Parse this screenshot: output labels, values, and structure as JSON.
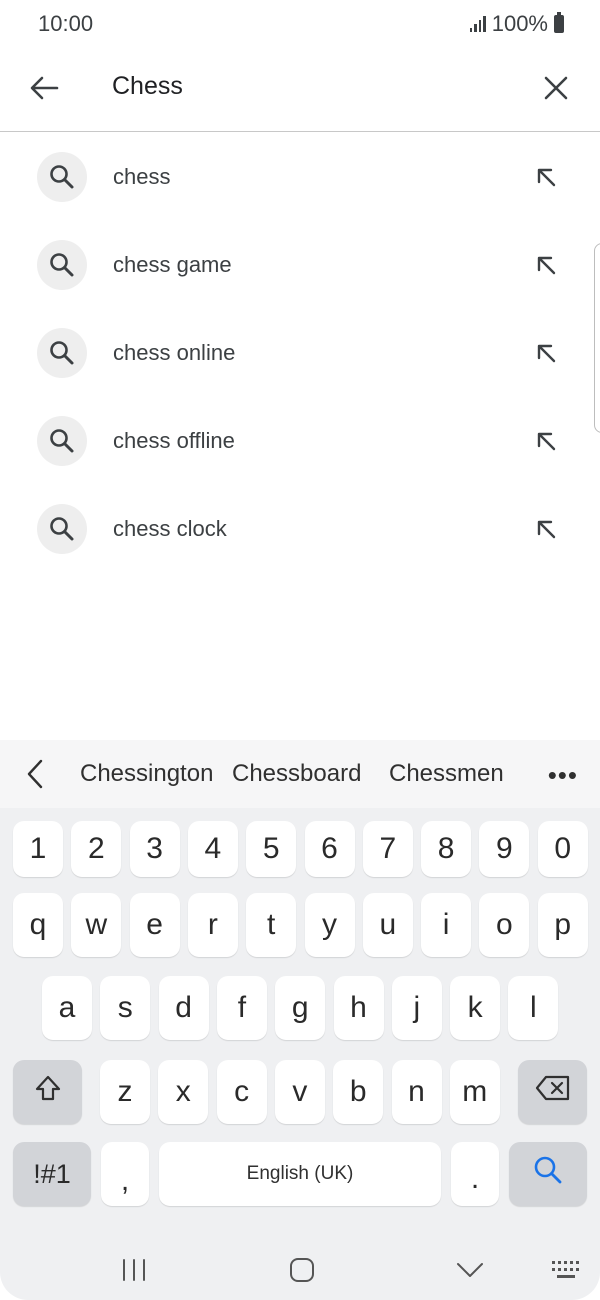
{
  "status_bar": {
    "time": "10:00",
    "battery": "100%"
  },
  "search": {
    "query": "Chess"
  },
  "suggestions": [
    {
      "text": "chess"
    },
    {
      "text": "chess game"
    },
    {
      "text": "chess online"
    },
    {
      "text": "chess offline"
    },
    {
      "text": "chess clock"
    }
  ],
  "keyboard": {
    "predictions": [
      "Chessington",
      "Chessboard",
      "Chessmen"
    ],
    "more": "•••",
    "number_row": [
      "1",
      "2",
      "3",
      "4",
      "5",
      "6",
      "7",
      "8",
      "9",
      "0"
    ],
    "row1": [
      "q",
      "w",
      "e",
      "r",
      "t",
      "y",
      "u",
      "i",
      "o",
      "p"
    ],
    "row2": [
      "a",
      "s",
      "d",
      "f",
      "g",
      "h",
      "j",
      "k",
      "l"
    ],
    "row3": [
      "z",
      "x",
      "c",
      "v",
      "b",
      "n",
      "m"
    ],
    "symbols_label": "!#1",
    "comma": ",",
    "space_label": "English (UK)",
    "period": ".",
    "accent_color": "#1a73e8"
  },
  "icons": {
    "back": "back-arrow-icon",
    "clear": "close-icon",
    "suggestion": "search-icon",
    "fill": "arrow-up-left-icon",
    "shift": "shift-icon",
    "backspace": "backspace-icon",
    "search_key": "search-icon",
    "nav_recents": "recents-icon",
    "nav_home": "home-icon",
    "nav_hide": "chevron-down-icon",
    "nav_keyboard": "keyboard-icon"
  }
}
